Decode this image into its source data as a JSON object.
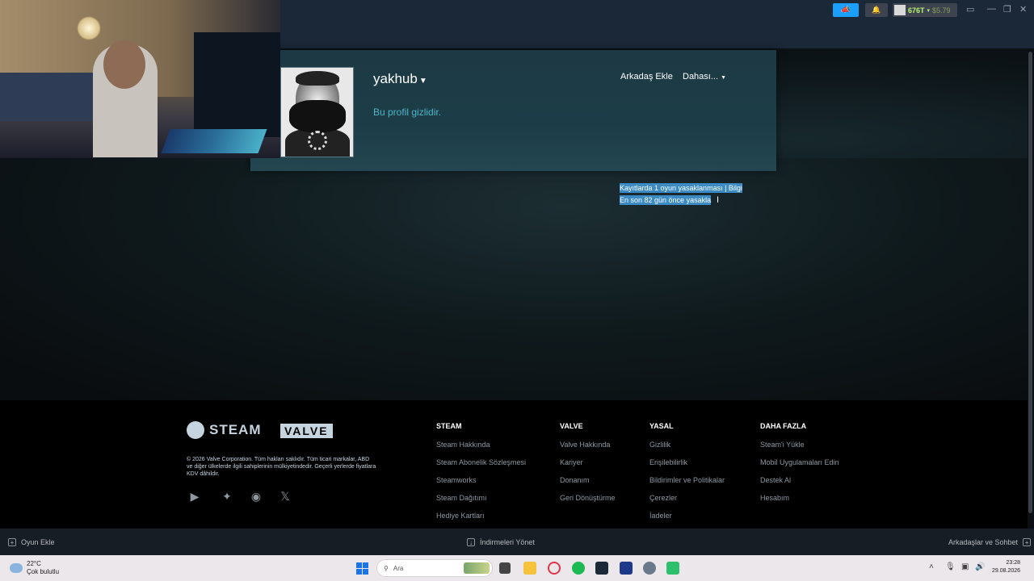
{
  "topbar": {
    "account_name": "676T",
    "account_balance": "$5.79"
  },
  "profile": {
    "name": "yakhub",
    "private_text": "Bu profil gizlidir.",
    "add_friend": "Arkadaş Ekle",
    "more": "Dahası..."
  },
  "bans": {
    "line1": "Kayıtlarda 1 oyun yasaklanması | Bilgi",
    "line2": "En son 82 gün önce yasakla"
  },
  "footer": {
    "steam_logo": "STEAM",
    "valve_logo": "VALVE",
    "copyright": "© 2026 Valve Corporation. Tüm hakları saklıdır. Tüm ticari markalar, ABD ve diğer ülkelerde ilgili sahiplerinin mülkiyetindedir. Geçerli yerlerde fiyatlara KDV dâhildir.",
    "columns": [
      {
        "heading": "STEAM",
        "links": [
          "Steam Hakkında",
          "Steam Abonelik Sözleşmesi",
          "Steamworks",
          "Steam Dağıtımı",
          "Hediye Kartları"
        ]
      },
      {
        "heading": "VALVE",
        "links": [
          "Valve Hakkında",
          "Kariyer",
          "Donanım",
          "Geri Dönüştürme"
        ]
      },
      {
        "heading": "YASAL",
        "links": [
          "Gizlilik",
          "Erişilebilirlik",
          "Bildirimler ve Politikalar",
          "Çerezler",
          "İadeler"
        ]
      },
      {
        "heading": "DAHA FAZLA",
        "links": [
          "Steam'i Yükle",
          "Mobil Uygulamaları Edin",
          "Destek Al",
          "Hesabım"
        ]
      }
    ]
  },
  "bottombar": {
    "add_game": "Oyun Ekle",
    "downloads": "İndirmeleri Yönet",
    "friends": "Arkadaşlar ve Sohbet"
  },
  "taskbar": {
    "temperature": "22°C",
    "weather": "Çok bulutlu",
    "search_placeholder": "Ara",
    "time": "23:28",
    "date": "29.08.2026"
  },
  "colors": {
    "accent": "#1a9fff",
    "profile_bg": "#1d3a44",
    "selection": "#3c8bc5",
    "private_text": "#57cbde"
  }
}
